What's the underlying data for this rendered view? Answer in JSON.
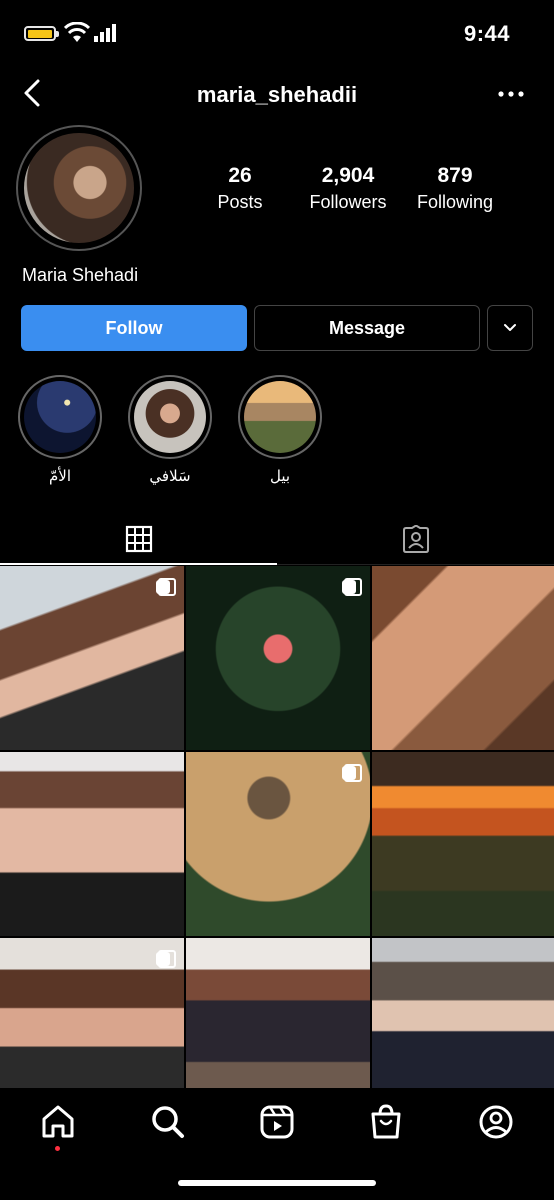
{
  "status_bar": {
    "time": "9:44"
  },
  "header": {
    "username": "maria_shehadii"
  },
  "profile": {
    "full_name": "Maria Shehadi",
    "stats": [
      {
        "value": "26",
        "label": "Posts"
      },
      {
        "value": "2,904",
        "label": "Followers"
      },
      {
        "value": "879",
        "label": "Following"
      }
    ]
  },
  "actions": {
    "follow_label": "Follow",
    "message_label": "Message"
  },
  "highlights": [
    {
      "label": "الأمّ"
    },
    {
      "label": "سَلافي"
    },
    {
      "label": "بيل"
    }
  ],
  "tabs": [
    {
      "icon": "grid-icon",
      "selected": true
    },
    {
      "icon": "tagged-icon",
      "selected": false
    }
  ],
  "posts": [
    {
      "multi": true
    },
    {
      "multi": true
    },
    {
      "multi": false
    },
    {
      "multi": false
    },
    {
      "multi": true
    },
    {
      "multi": false
    },
    {
      "multi": true
    },
    {
      "multi": false
    },
    {
      "multi": false
    }
  ],
  "bottom_nav": [
    "home-icon",
    "search-icon",
    "reels-icon",
    "shop-icon",
    "profile-icon"
  ],
  "colors": {
    "follow_button": "#3a8ef0",
    "background": "#000000",
    "notification_dot": "#ff3040",
    "battery": "#f5c518"
  }
}
